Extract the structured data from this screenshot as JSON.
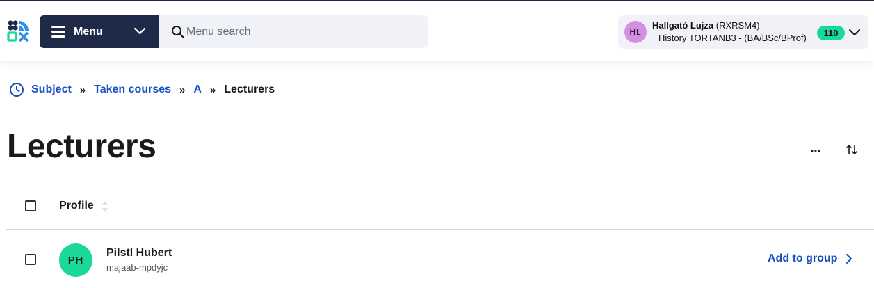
{
  "header": {
    "menu_label": "Menu",
    "search_placeholder": "Menu search",
    "user": {
      "name": "Hallgató Lujza",
      "code": "(RXRSM4)",
      "initials": "HL",
      "program": "History TORTANB3 - (BA/BSc/BProf)",
      "badge_count": "110",
      "avatar_color": "#d48fe0"
    },
    "brand_color": "#1e2a48",
    "accent_color": "#1bd89a"
  },
  "breadcrumb": {
    "items": [
      "Subject",
      "Taken courses",
      "A"
    ],
    "current": "Lecturers",
    "separator": "»"
  },
  "page": {
    "title": "Lecturers"
  },
  "table": {
    "column_header": "Profile",
    "rows": [
      {
        "initials": "PH",
        "name": "Pilstl Hubert",
        "code": "majaab-mpdyjc",
        "action": "Add to group"
      }
    ]
  }
}
